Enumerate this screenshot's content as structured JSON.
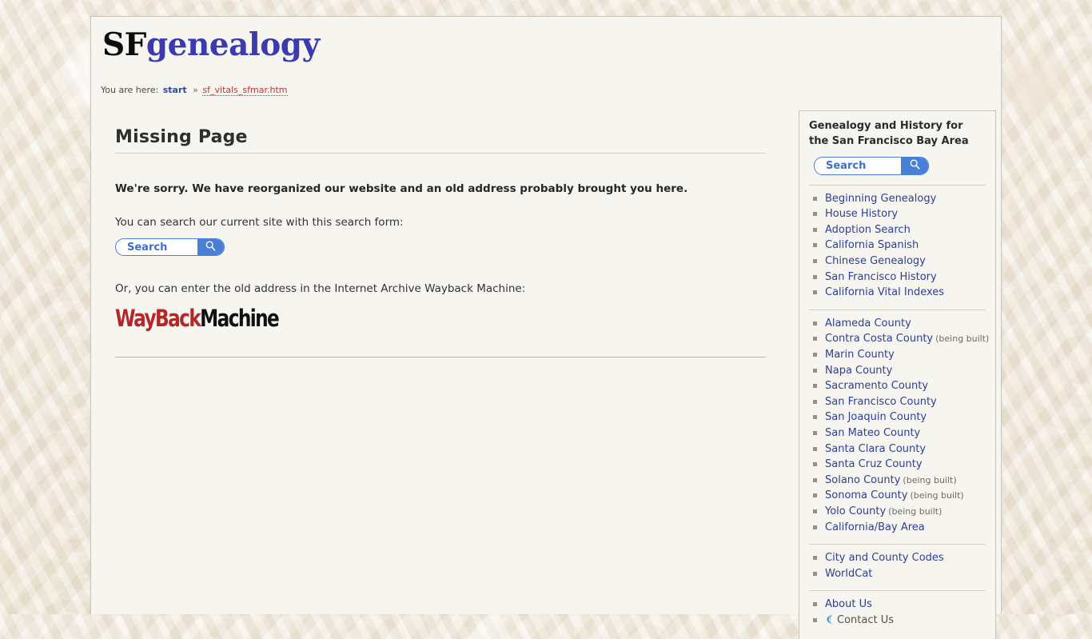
{
  "site": {
    "logo_prefix": "SF",
    "logo_suffix": "genealogy"
  },
  "breadcrumb": {
    "label": "You are here:",
    "home": "start",
    "separator": "»",
    "current": "sf_vitals_sfmar.htm"
  },
  "content": {
    "title": "Missing Page",
    "apology": "We're sorry. We have reorganized our website and an old address probably brought you here.",
    "search_intro": "You can search our current site with this search form:",
    "wayback_intro": "Or, you can enter the old address in the Internet Archive Wayback Machine:",
    "search": {
      "placeholder": "Search",
      "value": "",
      "button_icon": "search-icon"
    },
    "wayback_logo": {
      "part_red": "WayBack",
      "part_black": "Machine",
      "color_red": "#b52626",
      "color_black": "#111111"
    }
  },
  "sidebar": {
    "title": "Genealogy and History for the San Francisco Bay Area",
    "search": {
      "placeholder": "Search",
      "value": "",
      "button_icon": "search-icon"
    },
    "groups": [
      {
        "name": "topics",
        "items": [
          {
            "label": "Beginning Genealogy",
            "note": ""
          },
          {
            "label": "House History",
            "note": ""
          },
          {
            "label": "Adoption Search",
            "note": ""
          },
          {
            "label": "California Spanish",
            "note": ""
          },
          {
            "label": "Chinese Genealogy",
            "note": ""
          },
          {
            "label": "San Francisco History",
            "note": ""
          },
          {
            "label": "California Vital Indexes",
            "note": ""
          }
        ]
      },
      {
        "name": "counties",
        "items": [
          {
            "label": "Alameda County",
            "note": ""
          },
          {
            "label": "Contra Costa County",
            "note": "(being built)"
          },
          {
            "label": "Marin County",
            "note": ""
          },
          {
            "label": "Napa County",
            "note": ""
          },
          {
            "label": "Sacramento County",
            "note": ""
          },
          {
            "label": "San Francisco County",
            "note": ""
          },
          {
            "label": "San Joaquin County",
            "note": ""
          },
          {
            "label": "San Mateo County",
            "note": ""
          },
          {
            "label": "Santa Clara County",
            "note": ""
          },
          {
            "label": "Santa Cruz County",
            "note": ""
          },
          {
            "label": "Solano County",
            "note": "(being built)"
          },
          {
            "label": "Sonoma County",
            "note": "(being built)"
          },
          {
            "label": "Yolo County",
            "note": "(being built)"
          },
          {
            "label": "California/Bay Area",
            "note": ""
          }
        ]
      },
      {
        "name": "resources",
        "items": [
          {
            "label": "City and County Codes",
            "note": ""
          },
          {
            "label": "WorldCat",
            "note": ""
          }
        ]
      },
      {
        "name": "about",
        "items": [
          {
            "label": "About Us",
            "note": ""
          },
          {
            "label": "Contact Us",
            "note": "",
            "icon": "contact-ribbon-icon",
            "current": true
          }
        ]
      }
    ]
  },
  "colors": {
    "link_blue": "#2c3f96",
    "logo_blue": "#3b3bb0",
    "breadcrumb_red": "#b33a3a",
    "search_blue": "#4a7fd8",
    "page_bg": "#f7f5ef"
  }
}
